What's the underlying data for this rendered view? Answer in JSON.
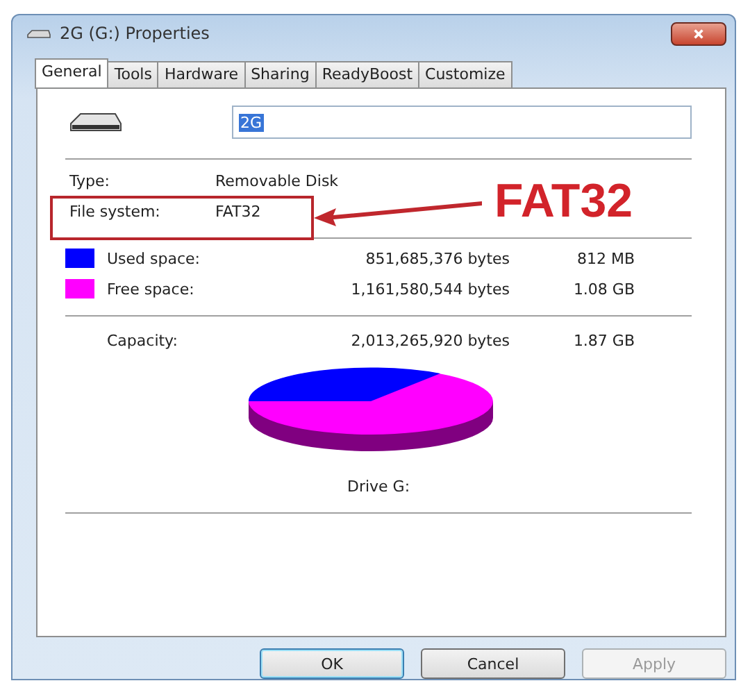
{
  "window": {
    "title": "2G (G:) Properties"
  },
  "tabs": [
    {
      "label": "General",
      "selected": true
    },
    {
      "label": "Tools",
      "selected": false
    },
    {
      "label": "Hardware",
      "selected": false
    },
    {
      "label": "Sharing",
      "selected": false
    },
    {
      "label": "ReadyBoost",
      "selected": false
    },
    {
      "label": "Customize",
      "selected": false
    }
  ],
  "name_field": {
    "value": "2G",
    "selected": true
  },
  "info": [
    {
      "label": "Type:",
      "value": "Removable Disk"
    },
    {
      "label": "File system:",
      "value": "FAT32"
    }
  ],
  "space": [
    {
      "label": "Used space:",
      "bytes": "851,685,376 bytes",
      "size": "812 MB",
      "color": "#0000ff"
    },
    {
      "label": "Free space:",
      "bytes": "1,161,580,544 bytes",
      "size": "1.08 GB",
      "color": "#ff00ff"
    }
  ],
  "capacity": {
    "label": "Capacity:",
    "bytes": "2,013,265,920 bytes",
    "size": "1.87 GB"
  },
  "drive_label": "Drive G:",
  "callout": {
    "text": "FAT32"
  },
  "buttons": [
    {
      "label": "OK",
      "default": true,
      "disabled": false
    },
    {
      "label": "Cancel",
      "default": false,
      "disabled": false
    },
    {
      "label": "Apply",
      "default": false,
      "disabled": true
    }
  ]
}
